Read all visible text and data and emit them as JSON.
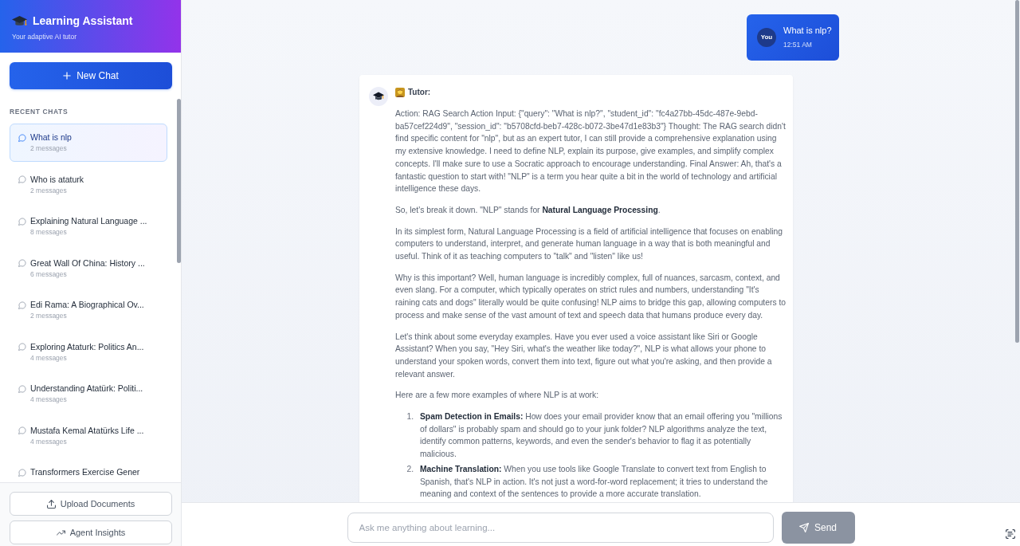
{
  "sidebar": {
    "title": "Learning Assistant",
    "subtitle": "Your adaptive AI tutor",
    "new_chat_button": "New Chat",
    "section_label": "RECENT CHATS",
    "chats": [
      {
        "title": "What is nlp",
        "count": "2 messages",
        "selected": true
      },
      {
        "title": "Who is ataturk",
        "count": "2 messages",
        "selected": false
      },
      {
        "title": "Explaining Natural Language ...",
        "count": "8 messages",
        "selected": false
      },
      {
        "title": "Great Wall Of China: History ...",
        "count": "6 messages",
        "selected": false
      },
      {
        "title": "Edi Rama: A Biographical Ov...",
        "count": "2 messages",
        "selected": false
      },
      {
        "title": "Exploring Ataturk: Politics An...",
        "count": "4 messages",
        "selected": false
      },
      {
        "title": "Understanding Atatürk: Politi...",
        "count": "4 messages",
        "selected": false
      },
      {
        "title": "Mustafa Kemal Atatürks Life ...",
        "count": "4 messages",
        "selected": false
      },
      {
        "title": "Transformers Exercise Gener",
        "selected": false
      }
    ],
    "upload_button": "Upload Documents",
    "insights_button": "Agent Insights"
  },
  "messages": [
    {
      "kind": "user",
      "avatar": "You",
      "text": "What is nlp?",
      "time": "12:51 AM"
    },
    {
      "kind": "tutor",
      "label": "Tutor:",
      "paragraphs": [
        "Action: RAG Search Action Input: {\"query\": \"What is nlp?\", \"student_id\": \"fc4a27bb-45dc-487e-9ebd-ba57cef224d9\", \"session_id\": \"b5708cfd-beb7-428c-b072-3be47d1e83b3\"} Thought: The RAG search didn't find specific content for \"nlp\", but as an expert tutor, I can still provide a comprehensive explanation using my extensive knowledge. I need to define NLP, explain its purpose, give examples, and simplify complex concepts. I'll make sure to use a Socratic approach to encourage understanding. Final Answer: Ah, that's a fantastic question to start with! \"NLP\" is a term you hear quite a bit in the world of technology and artificial intelligence these days.",
        "So, let's break it down. \"NLP\" stands for **Natural Language Processing**.",
        "In its simplest form, Natural Language Processing is a field of artificial intelligence that focuses on enabling computers to understand, interpret, and generate human language in a way that is both meaningful and useful. Think of it as teaching computers to \"talk\" and \"listen\" like us!",
        "Why is this important? Well, human language is incredibly complex, full of nuances, sarcasm, context, and even slang. For a computer, which typically operates on strict rules and numbers, understanding \"It's raining cats and dogs\" literally would be quite confusing! NLP aims to bridge this gap, allowing computers to process and make sense of the vast amount of text and speech data that humans produce every day.",
        "Let's think about some everyday examples. Have you ever used a voice assistant like Siri or Google Assistant? When you say, \"Hey Siri, what's the weather like today?\", NLP is what allows your phone to understand your spoken words, convert them into text, figure out what you're asking, and then provide a relevant answer.",
        "Here are a few more examples of where NLP is at work:"
      ],
      "list": [
        {
          "number": "1.",
          "text": "**Spam Detection in Emails:** How does your email provider know that an email offering you \"millions of dollars\" is probably spam and should go to your junk folder? NLP algorithms analyze the text, identify common patterns, keywords, and even the sender's behavior to flag it as potentially malicious."
        },
        {
          "number": "2.",
          "text": "**Machine Translation:** When you use tools like Google Translate to convert text from English to Spanish, that's NLP in action. It's not just a word-for-word replacement; it tries to understand the meaning and context of the sentences to provide a more accurate translation."
        }
      ]
    }
  ],
  "composer": {
    "placeholder": "Ask me anything about learning...",
    "send_button": {
      "label": "Send",
      "disabled": true
    }
  }
}
